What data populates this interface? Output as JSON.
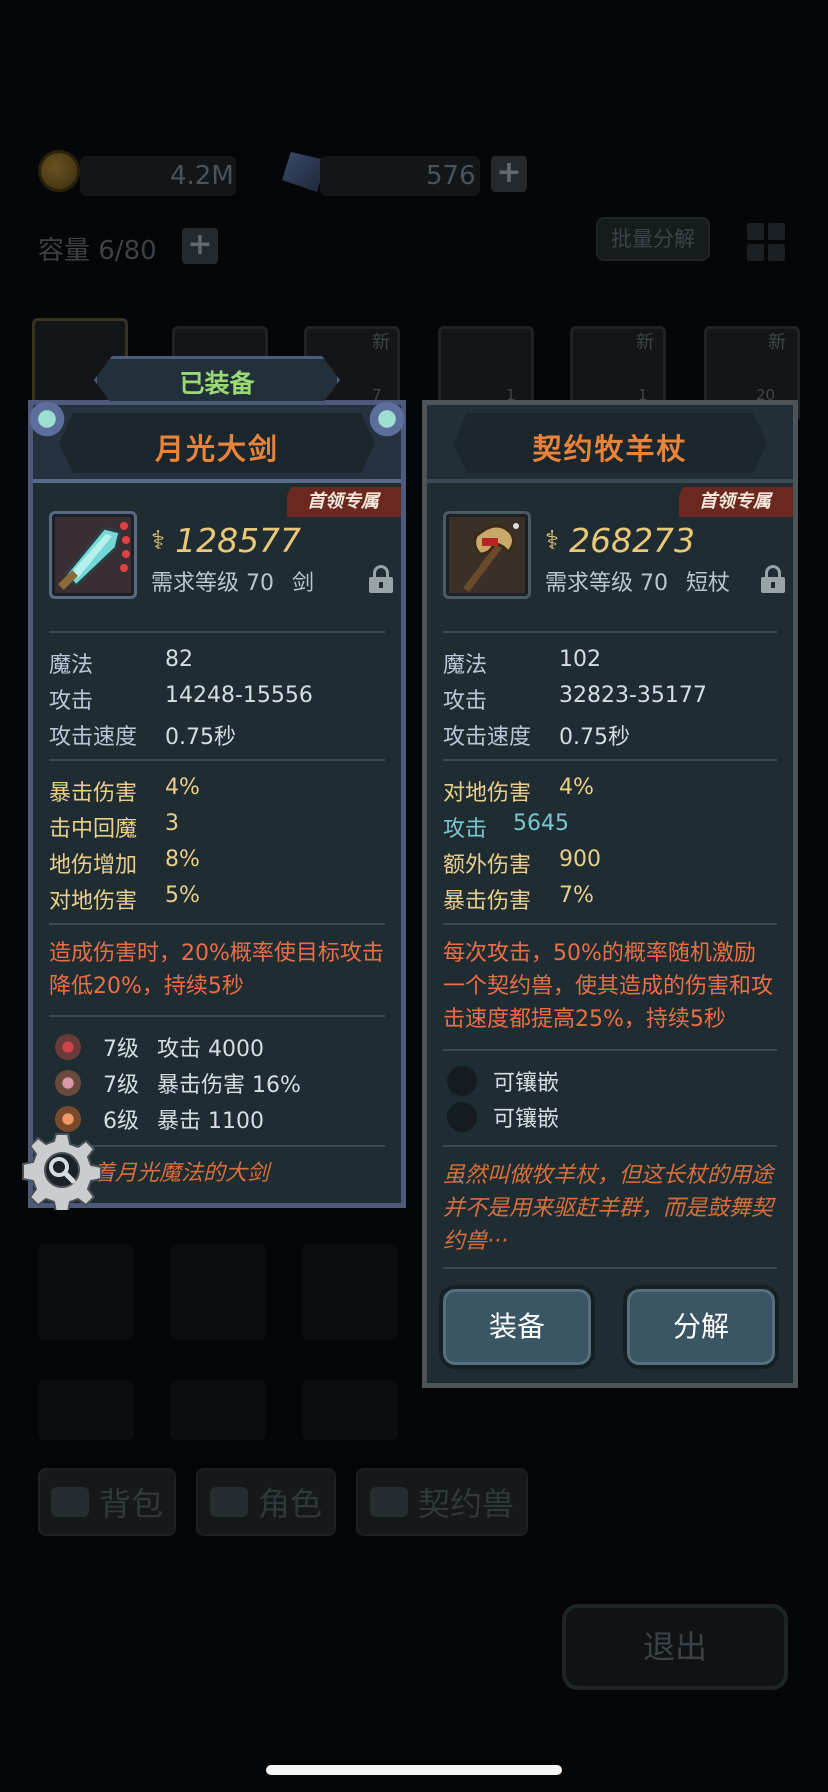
{
  "background": {
    "gold_amount": "4.2M",
    "gem_amount": "576",
    "capacity_label": "容量 6/80",
    "bulk_dismantle": "批量分解",
    "inventory_badges": [
      "新",
      "新",
      "新",
      "新"
    ],
    "inventory_counts": [
      "7",
      "1",
      "1",
      "20"
    ],
    "tabs": [
      "背包",
      "角色",
      "契约兽"
    ],
    "exit": "退出"
  },
  "equipped_tag": "已装备",
  "left": {
    "name": "月光大剑",
    "badge": "首领专属",
    "price": "128577",
    "req_level": "需求等级 70",
    "type": "剑",
    "base_stats": [
      {
        "k": "魔法",
        "v": "82"
      },
      {
        "k": "攻击",
        "v": "14248-15556"
      },
      {
        "k": "攻击速度",
        "v": "0.75秒"
      }
    ],
    "bonus_stats": [
      {
        "k": "暴击伤害",
        "v": "4%"
      },
      {
        "k": "击中回魔",
        "v": "3"
      },
      {
        "k": "地伤增加",
        "v": "8%"
      },
      {
        "k": "对地伤害",
        "v": "5%"
      }
    ],
    "effect": "造成伤害时，20%概率使目标攻击降低20%，持续5秒",
    "gems": [
      {
        "lv": "7级",
        "text": "攻击 4000"
      },
      {
        "lv": "7级",
        "text": "暴击伤害 16%"
      },
      {
        "lv": "6级",
        "text": "暴击 1100"
      }
    ],
    "flavor": "蕴含着月光魔法的大剑"
  },
  "right": {
    "name": "契约牧羊杖",
    "badge": "首领专属",
    "price": "268273",
    "req_level": "需求等级 70",
    "type": "短杖",
    "base_stats": [
      {
        "k": "魔法",
        "v": "102"
      },
      {
        "k": "攻击",
        "v": "32823-35177"
      },
      {
        "k": "攻击速度",
        "v": "0.75秒"
      }
    ],
    "bonus_stats": [
      {
        "k": "对地伤害",
        "v": "4%"
      },
      {
        "k": "攻击",
        "v": "5645"
      },
      {
        "k": "额外伤害",
        "v": "900"
      },
      {
        "k": "暴击伤害",
        "v": "7%"
      }
    ],
    "effect": "每次攻击，50%的概率随机激励一个契约兽，使其造成的伤害和攻击速度都提高25%，持续5秒",
    "sockets": [
      "可镶嵌",
      "可镶嵌"
    ],
    "flavor": "虽然叫做牧羊杖，但这长杖的用途并不是用来驱赶羊群，而是鼓舞契约兽···",
    "equip_button": "装备",
    "dismantle_button": "分解"
  },
  "colors": {
    "title": "#e8833b",
    "gold_stat": "#e9cf8a",
    "effect_text": "#ec6e44",
    "equipped_tag": "#9bd876"
  }
}
